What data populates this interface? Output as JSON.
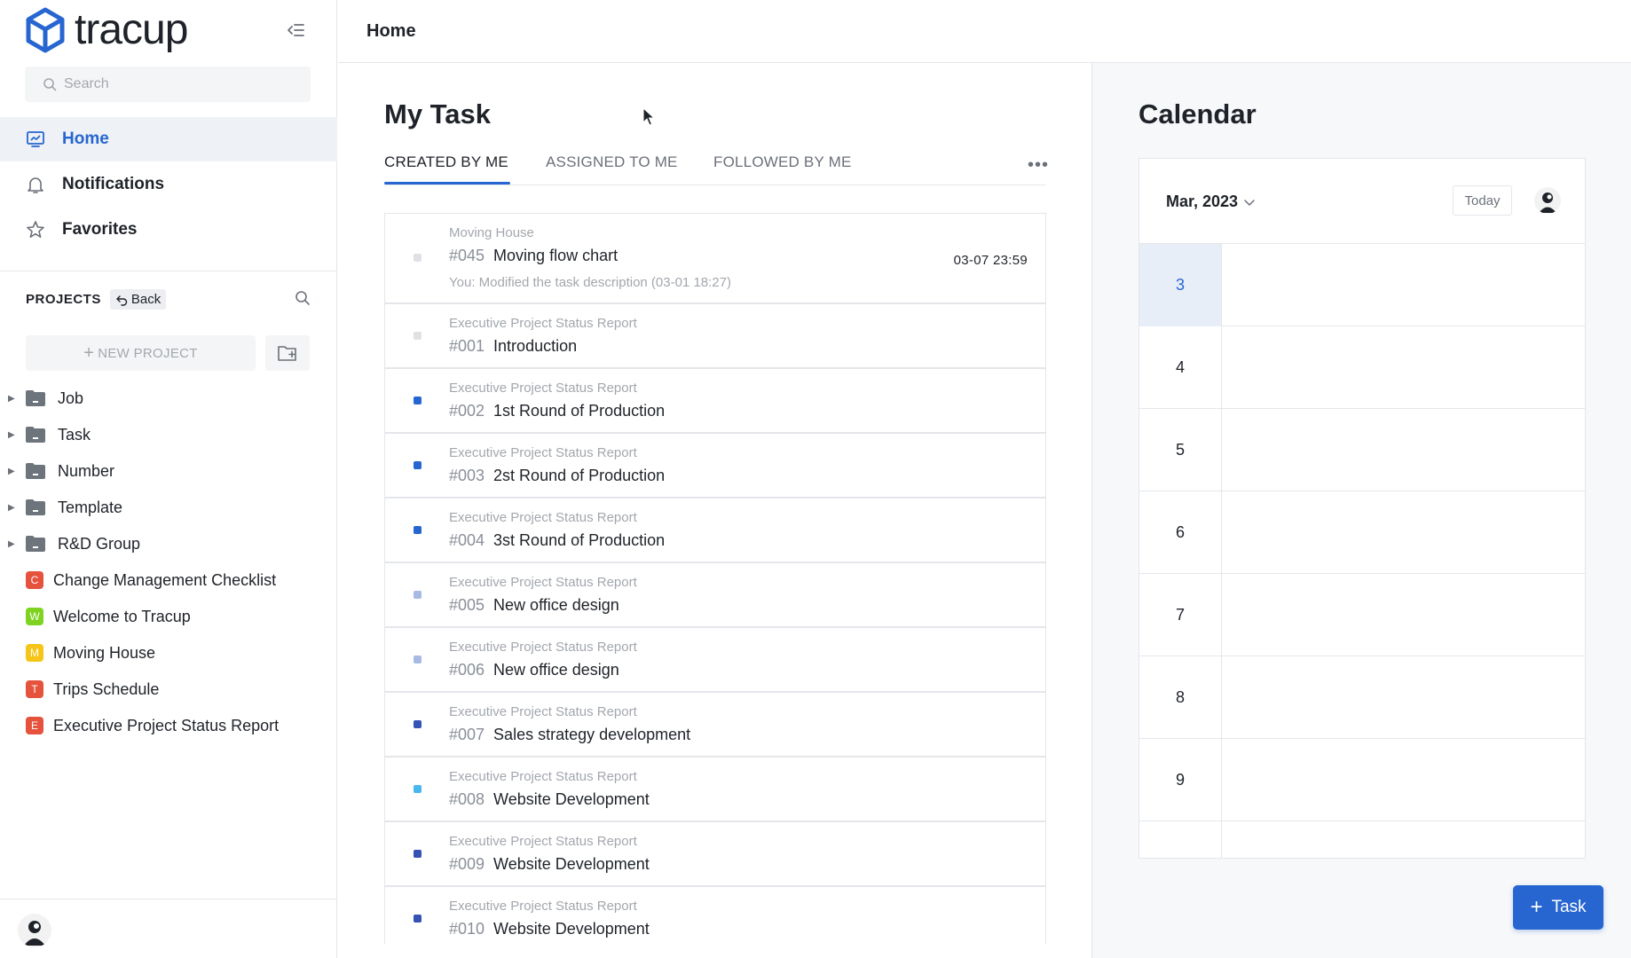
{
  "brand": {
    "name": "tracup"
  },
  "colors": {
    "accent": "#2766d0",
    "background": "#ffffff",
    "panel_bg": "#f7f8fa"
  },
  "sidebar": {
    "search": {
      "placeholder": "Search",
      "value": ""
    },
    "nav": [
      {
        "label": "Home",
        "icon": "monitor-chart-icon",
        "active": true
      },
      {
        "label": "Notifications",
        "icon": "bell-icon",
        "active": false
      },
      {
        "label": "Favorites",
        "icon": "star-icon",
        "active": false
      }
    ],
    "projects_title": "PROJECTS",
    "back_label": "Back",
    "new_project_label": "NEW PROJECT",
    "folders": [
      {
        "label": "Job"
      },
      {
        "label": "Task"
      },
      {
        "label": "Number"
      },
      {
        "label": "Template"
      },
      {
        "label": "R&D Group"
      }
    ],
    "projects": [
      {
        "label": "Change Management Checklist",
        "initial": "C",
        "color": "#e5533d"
      },
      {
        "label": "Welcome to Tracup",
        "initial": "W",
        "color": "#7ed321"
      },
      {
        "label": "Moving House",
        "initial": "M",
        "color": "#f5c518"
      },
      {
        "label": "Trips Schedule",
        "initial": "T",
        "color": "#e5533d"
      },
      {
        "label": "Executive Project Status Report",
        "initial": "E",
        "color": "#e5533d"
      }
    ]
  },
  "topbar": {
    "title": "Home"
  },
  "my_task": {
    "title": "My Task",
    "tabs": [
      "CREATED BY ME",
      "ASSIGNED TO ME",
      "FOLLOWED BY ME"
    ],
    "active_tab": 0,
    "tasks": [
      {
        "project": "Moving House",
        "id": "#045",
        "name": "Moving flow chart",
        "meta": "You:   Modified the task description  (03-01 18:27)",
        "date": "03-07 23:59",
        "dot": "#dfe1e5"
      },
      {
        "project": "Executive Project Status Report",
        "id": "#001",
        "name": "Introduction",
        "dot": "#dfe1e5"
      },
      {
        "project": "Executive Project Status Report",
        "id": "#002",
        "name": "1st Round of Production",
        "dot": "#2766d0"
      },
      {
        "project": "Executive Project Status Report",
        "id": "#003",
        "name": "2st Round of Production",
        "dot": "#2766d0"
      },
      {
        "project": "Executive Project Status Report",
        "id": "#004",
        "name": "3st Round of Production",
        "dot": "#2766d0"
      },
      {
        "project": "Executive Project Status Report",
        "id": "#005",
        "name": "New office design",
        "dot": "#a8b9e6"
      },
      {
        "project": "Executive Project Status Report",
        "id": "#006",
        "name": "New office design",
        "dot": "#a8b9e6"
      },
      {
        "project": "Executive Project Status Report",
        "id": "#007",
        "name": "Sales strategy development",
        "dot": "#3552b5"
      },
      {
        "project": "Executive Project Status Report",
        "id": "#008",
        "name": "Website Development",
        "dot": "#4ab8f0"
      },
      {
        "project": "Executive Project Status Report",
        "id": "#009",
        "name": "Website Development",
        "dot": "#3552b5"
      },
      {
        "project": "Executive Project Status Report",
        "id": "#010",
        "name": "Website Development",
        "dot": "#3552b5"
      }
    ]
  },
  "calendar": {
    "title": "Calendar",
    "month_label": "Mar, 2023",
    "today_label": "Today",
    "days": [
      "3",
      "4",
      "5",
      "6",
      "7",
      "8",
      "9"
    ],
    "today": "3"
  },
  "add_task": {
    "label": "Task"
  }
}
